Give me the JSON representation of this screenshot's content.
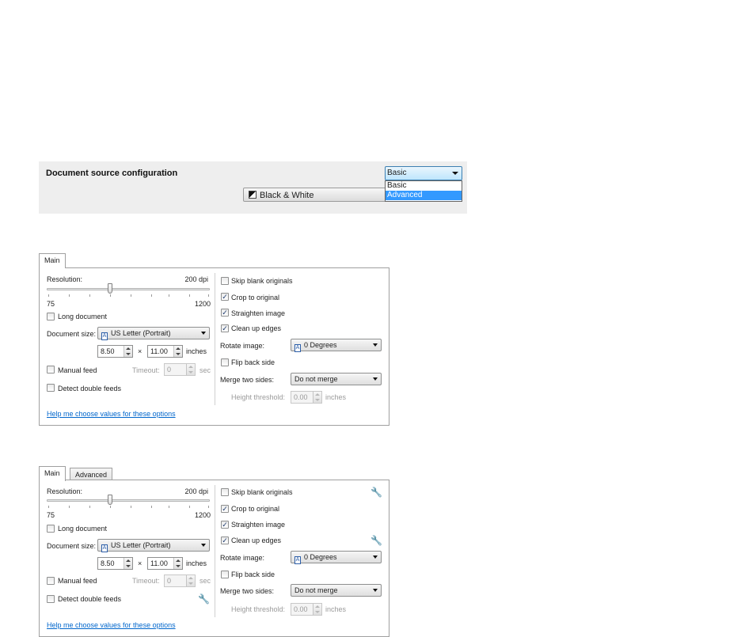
{
  "config": {
    "title": "Document source configuration",
    "mode_button": "Black & White",
    "profile_selected": "Basic",
    "profile_options": [
      "Basic",
      "Advanced"
    ],
    "profile_highlighted": "Advanced"
  },
  "dialog1": {
    "tabs": [
      "Main"
    ],
    "resolution_label": "Resolution:",
    "resolution_value": "200 dpi",
    "slider_min": "75",
    "slider_max": "1200",
    "long_document": "Long document",
    "document_size_label": "Document size:",
    "document_size": "US Letter (Portrait)",
    "width": "8.50",
    "times": "×",
    "height": "11.00",
    "units": "inches",
    "manual_feed": "Manual feed",
    "timeout_label": "Timeout:",
    "timeout_value": "0",
    "timeout_units": "sec",
    "detect_double_feeds": "Detect double feeds",
    "skip_blank": "Skip blank originals",
    "crop": "Crop to original",
    "straighten": "Straighten image",
    "clean_edges": "Clean up edges",
    "rotate_label": "Rotate image:",
    "rotate_value": "0 Degrees",
    "flip_back": "Flip back side",
    "merge_label": "Merge two sides:",
    "merge_value": "Do not merge",
    "height_threshold_label": "Height threshold:",
    "height_threshold_value": "0.00",
    "height_threshold_units": "inches",
    "help_link": "Help me choose values for these options"
  },
  "dialog2": {
    "tabs": [
      "Main",
      "Advanced"
    ],
    "resolution_label": "Resolution:",
    "resolution_value": "200 dpi",
    "slider_min": "75",
    "slider_max": "1200",
    "long_document": "Long document",
    "document_size_label": "Document size:",
    "document_size": "US Letter (Portrait)",
    "width": "8.50",
    "times": "×",
    "height": "11.00",
    "units": "inches",
    "manual_feed": "Manual feed",
    "timeout_label": "Timeout:",
    "timeout_value": "0",
    "timeout_units": "sec",
    "detect_double_feeds": "Detect double feeds",
    "skip_blank": "Skip blank originals",
    "crop": "Crop to original",
    "straighten": "Straighten image",
    "clean_edges": "Clean up edges",
    "rotate_label": "Rotate image:",
    "rotate_value": "0 Degrees",
    "flip_back": "Flip back side",
    "merge_label": "Merge two sides:",
    "merge_value": "Do not merge",
    "height_threshold_label": "Height threshold:",
    "height_threshold_value": "0.00",
    "height_threshold_units": "inches",
    "help_link": "Help me choose values for these options"
  },
  "checked_mark": "✓",
  "resolution_slider_fraction": 0.39
}
